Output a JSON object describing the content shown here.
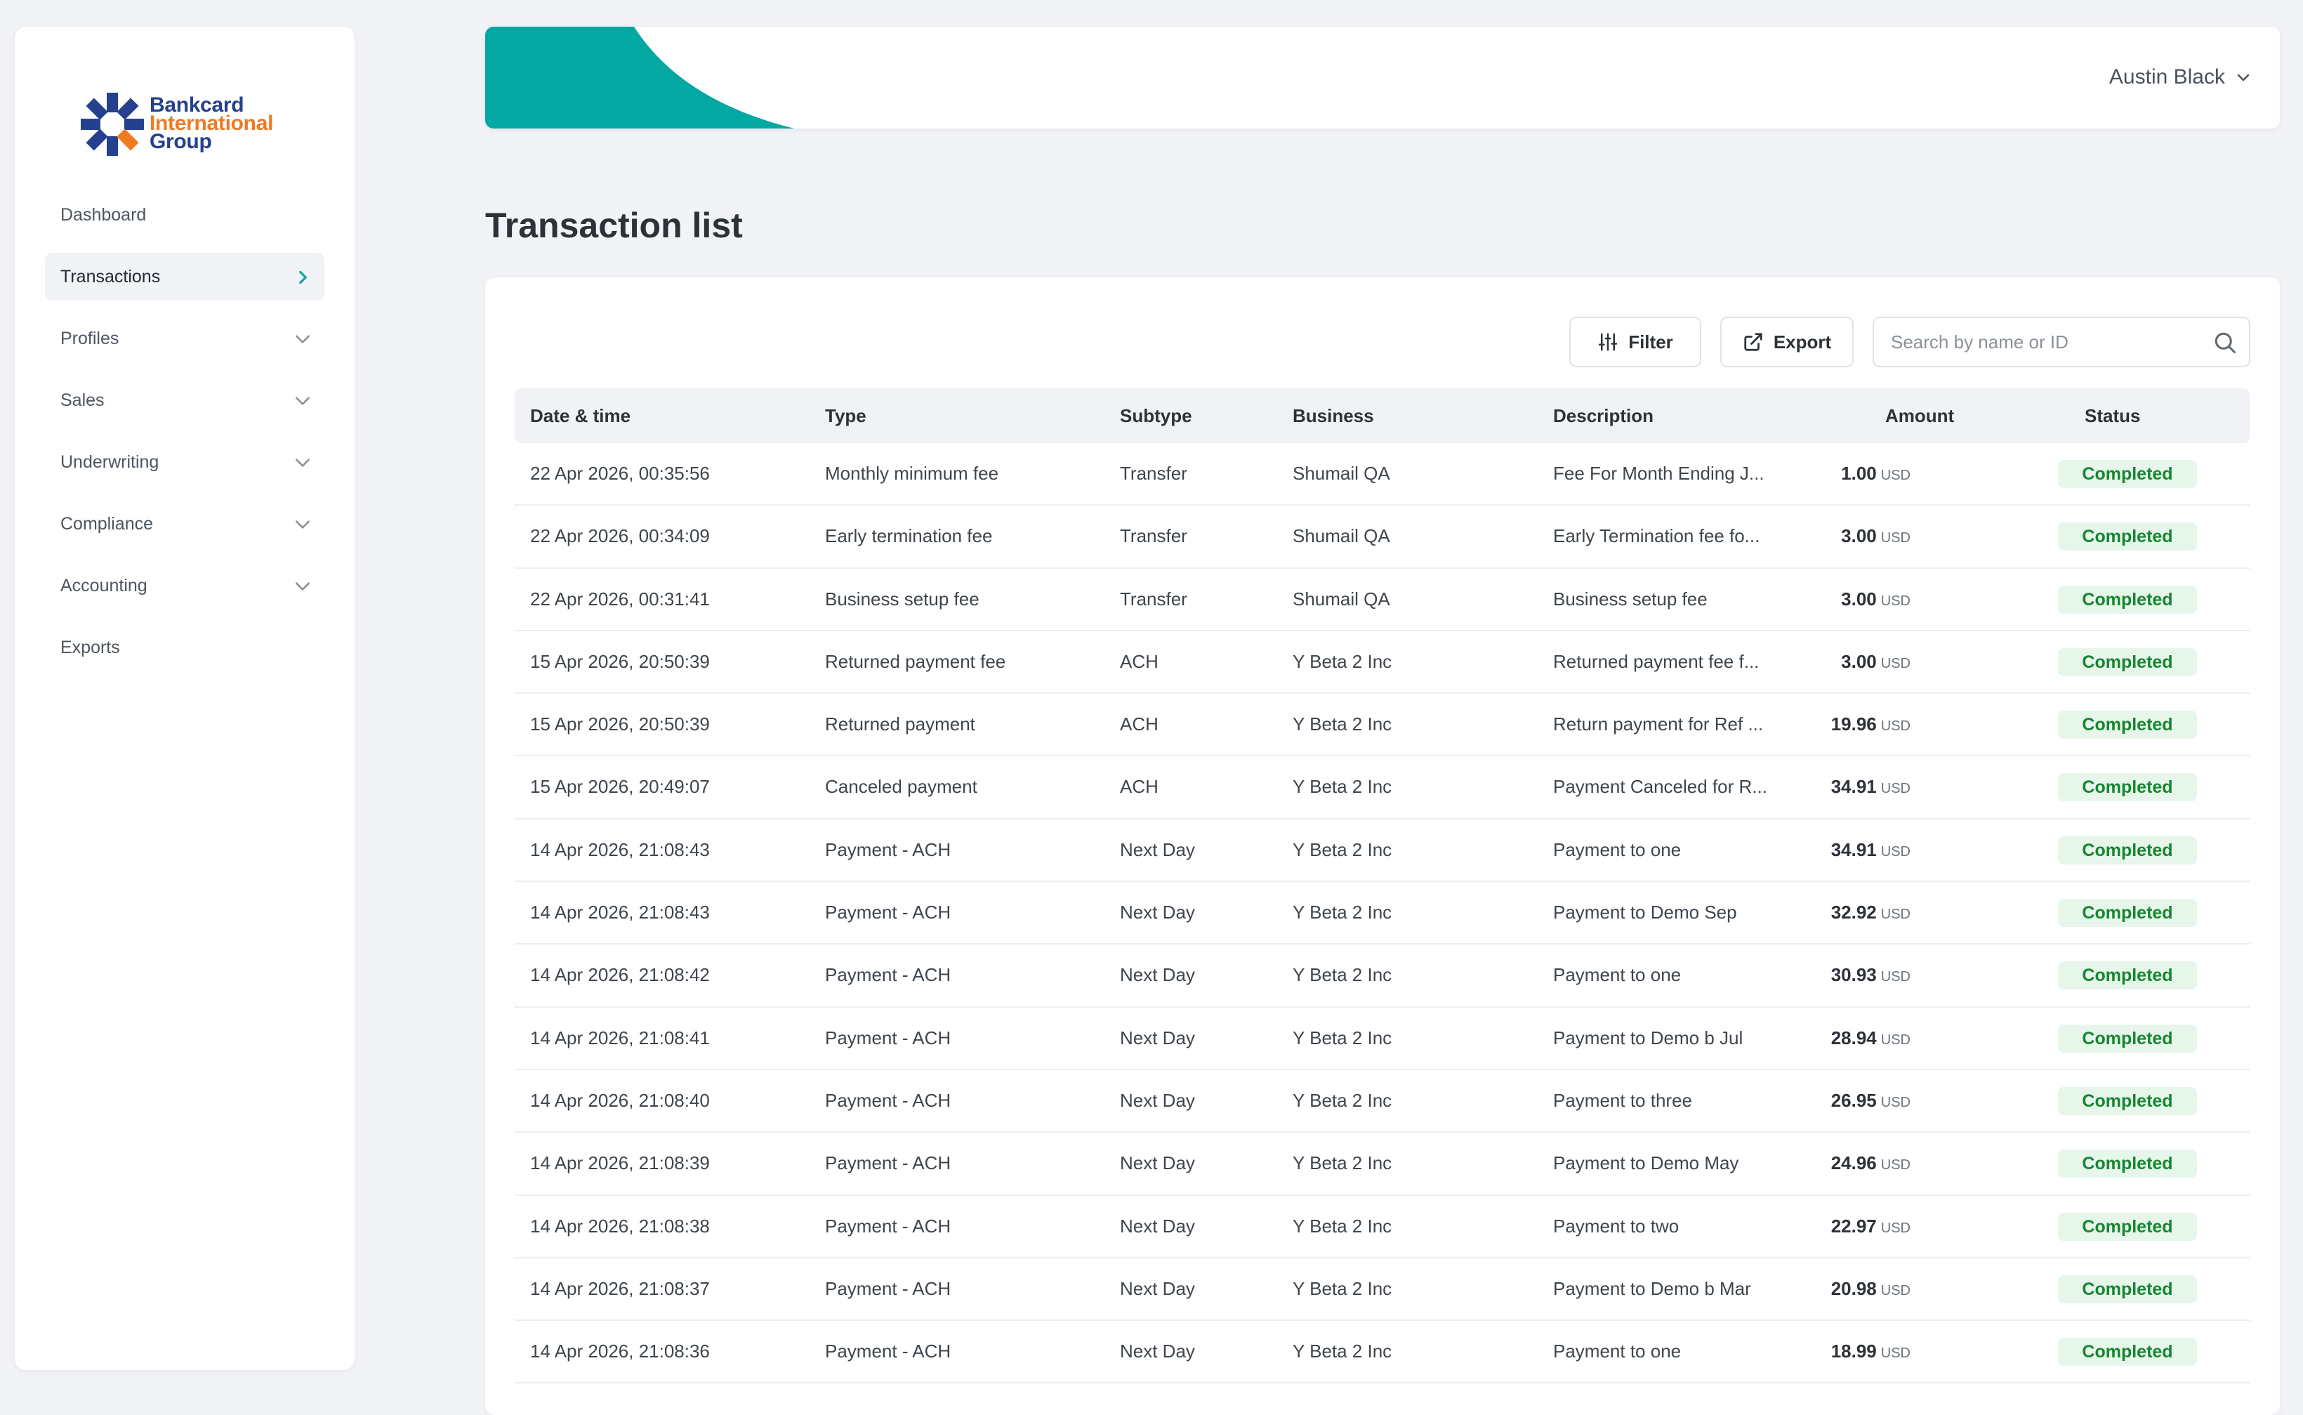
{
  "brand": {
    "logo_line1": "Bankcard",
    "logo_line2": "International",
    "logo_line3": "Group",
    "colors": {
      "navy": "#24408e",
      "orange": "#ee7a22",
      "teal": "#03a8a2"
    }
  },
  "sidebar": {
    "items": [
      {
        "label": "Dashboard",
        "icon": "",
        "active": false
      },
      {
        "label": "Transactions",
        "icon": "chevron-right-icon",
        "active": true
      },
      {
        "label": "Profiles",
        "icon": "chevron-down-icon",
        "active": false
      },
      {
        "label": "Sales",
        "icon": "chevron-down-icon",
        "active": false
      },
      {
        "label": "Underwriting",
        "icon": "chevron-down-icon",
        "active": false
      },
      {
        "label": "Compliance",
        "icon": "chevron-down-icon",
        "active": false
      },
      {
        "label": "Accounting",
        "icon": "chevron-down-icon",
        "active": false
      },
      {
        "label": "Exports",
        "icon": "",
        "active": false
      }
    ]
  },
  "header": {
    "user_name": "Austin Black"
  },
  "page": {
    "title": "Transaction list"
  },
  "toolbar": {
    "filter_label": "Filter",
    "export_label": "Export",
    "search_placeholder": "Search by name or ID"
  },
  "table": {
    "columns": [
      "Date & time",
      "Type",
      "Subtype",
      "Business",
      "Description",
      "Amount",
      "Status"
    ],
    "rows": [
      {
        "datetime": "22 Apr 2026, 00:35:56",
        "type": "Monthly minimum fee",
        "subtype": "Transfer",
        "business": "Shumail QA",
        "description": "Fee For Month Ending J...",
        "amount": "1.00",
        "currency": "USD",
        "status": "Completed"
      },
      {
        "datetime": "22 Apr 2026, 00:34:09",
        "type": "Early termination fee",
        "subtype": "Transfer",
        "business": "Shumail QA",
        "description": "Early Termination fee fo...",
        "amount": "3.00",
        "currency": "USD",
        "status": "Completed"
      },
      {
        "datetime": "22 Apr 2026, 00:31:41",
        "type": "Business setup fee",
        "subtype": "Transfer",
        "business": "Shumail QA",
        "description": "Business setup fee",
        "amount": "3.00",
        "currency": "USD",
        "status": "Completed"
      },
      {
        "datetime": "15 Apr 2026, 20:50:39",
        "type": "Returned payment fee",
        "subtype": "ACH",
        "business": "Y Beta 2 Inc",
        "description": "Returned payment fee f...",
        "amount": "3.00",
        "currency": "USD",
        "status": "Completed"
      },
      {
        "datetime": "15 Apr 2026, 20:50:39",
        "type": "Returned payment",
        "subtype": "ACH",
        "business": "Y Beta 2 Inc",
        "description": "Return payment for Ref ...",
        "amount": "19.96",
        "currency": "USD",
        "status": "Completed"
      },
      {
        "datetime": "15 Apr 2026, 20:49:07",
        "type": "Canceled payment",
        "subtype": "ACH",
        "business": "Y Beta 2 Inc",
        "description": "Payment Canceled for R...",
        "amount": "34.91",
        "currency": "USD",
        "status": "Completed"
      },
      {
        "datetime": "14 Apr 2026, 21:08:43",
        "type": "Payment - ACH",
        "subtype": "Next Day",
        "business": "Y Beta 2 Inc",
        "description": "Payment to one",
        "amount": "34.91",
        "currency": "USD",
        "status": "Completed"
      },
      {
        "datetime": "14 Apr 2026, 21:08:43",
        "type": "Payment - ACH",
        "subtype": "Next Day",
        "business": "Y Beta 2 Inc",
        "description": "Payment to Demo Sep",
        "amount": "32.92",
        "currency": "USD",
        "status": "Completed"
      },
      {
        "datetime": "14 Apr 2026, 21:08:42",
        "type": "Payment - ACH",
        "subtype": "Next Day",
        "business": "Y Beta 2 Inc",
        "description": "Payment to one",
        "amount": "30.93",
        "currency": "USD",
        "status": "Completed"
      },
      {
        "datetime": "14 Apr 2026, 21:08:41",
        "type": "Payment - ACH",
        "subtype": "Next Day",
        "business": "Y Beta 2 Inc",
        "description": "Payment to Demo b Jul",
        "amount": "28.94",
        "currency": "USD",
        "status": "Completed"
      },
      {
        "datetime": "14 Apr 2026, 21:08:40",
        "type": "Payment - ACH",
        "subtype": "Next Day",
        "business": "Y Beta 2 Inc",
        "description": "Payment to three",
        "amount": "26.95",
        "currency": "USD",
        "status": "Completed"
      },
      {
        "datetime": "14 Apr 2026, 21:08:39",
        "type": "Payment - ACH",
        "subtype": "Next Day",
        "business": "Y Beta 2 Inc",
        "description": "Payment to Demo May",
        "amount": "24.96",
        "currency": "USD",
        "status": "Completed"
      },
      {
        "datetime": "14 Apr 2026, 21:08:38",
        "type": "Payment - ACH",
        "subtype": "Next Day",
        "business": "Y Beta 2 Inc",
        "description": "Payment to two",
        "amount": "22.97",
        "currency": "USD",
        "status": "Completed"
      },
      {
        "datetime": "14 Apr 2026, 21:08:37",
        "type": "Payment - ACH",
        "subtype": "Next Day",
        "business": "Y Beta 2 Inc",
        "description": "Payment to Demo b Mar",
        "amount": "20.98",
        "currency": "USD",
        "status": "Completed"
      },
      {
        "datetime": "14 Apr 2026, 21:08:36",
        "type": "Payment - ACH",
        "subtype": "Next Day",
        "business": "Y Beta 2 Inc",
        "description": "Payment to one",
        "amount": "18.99",
        "currency": "USD",
        "status": "Completed"
      }
    ]
  }
}
